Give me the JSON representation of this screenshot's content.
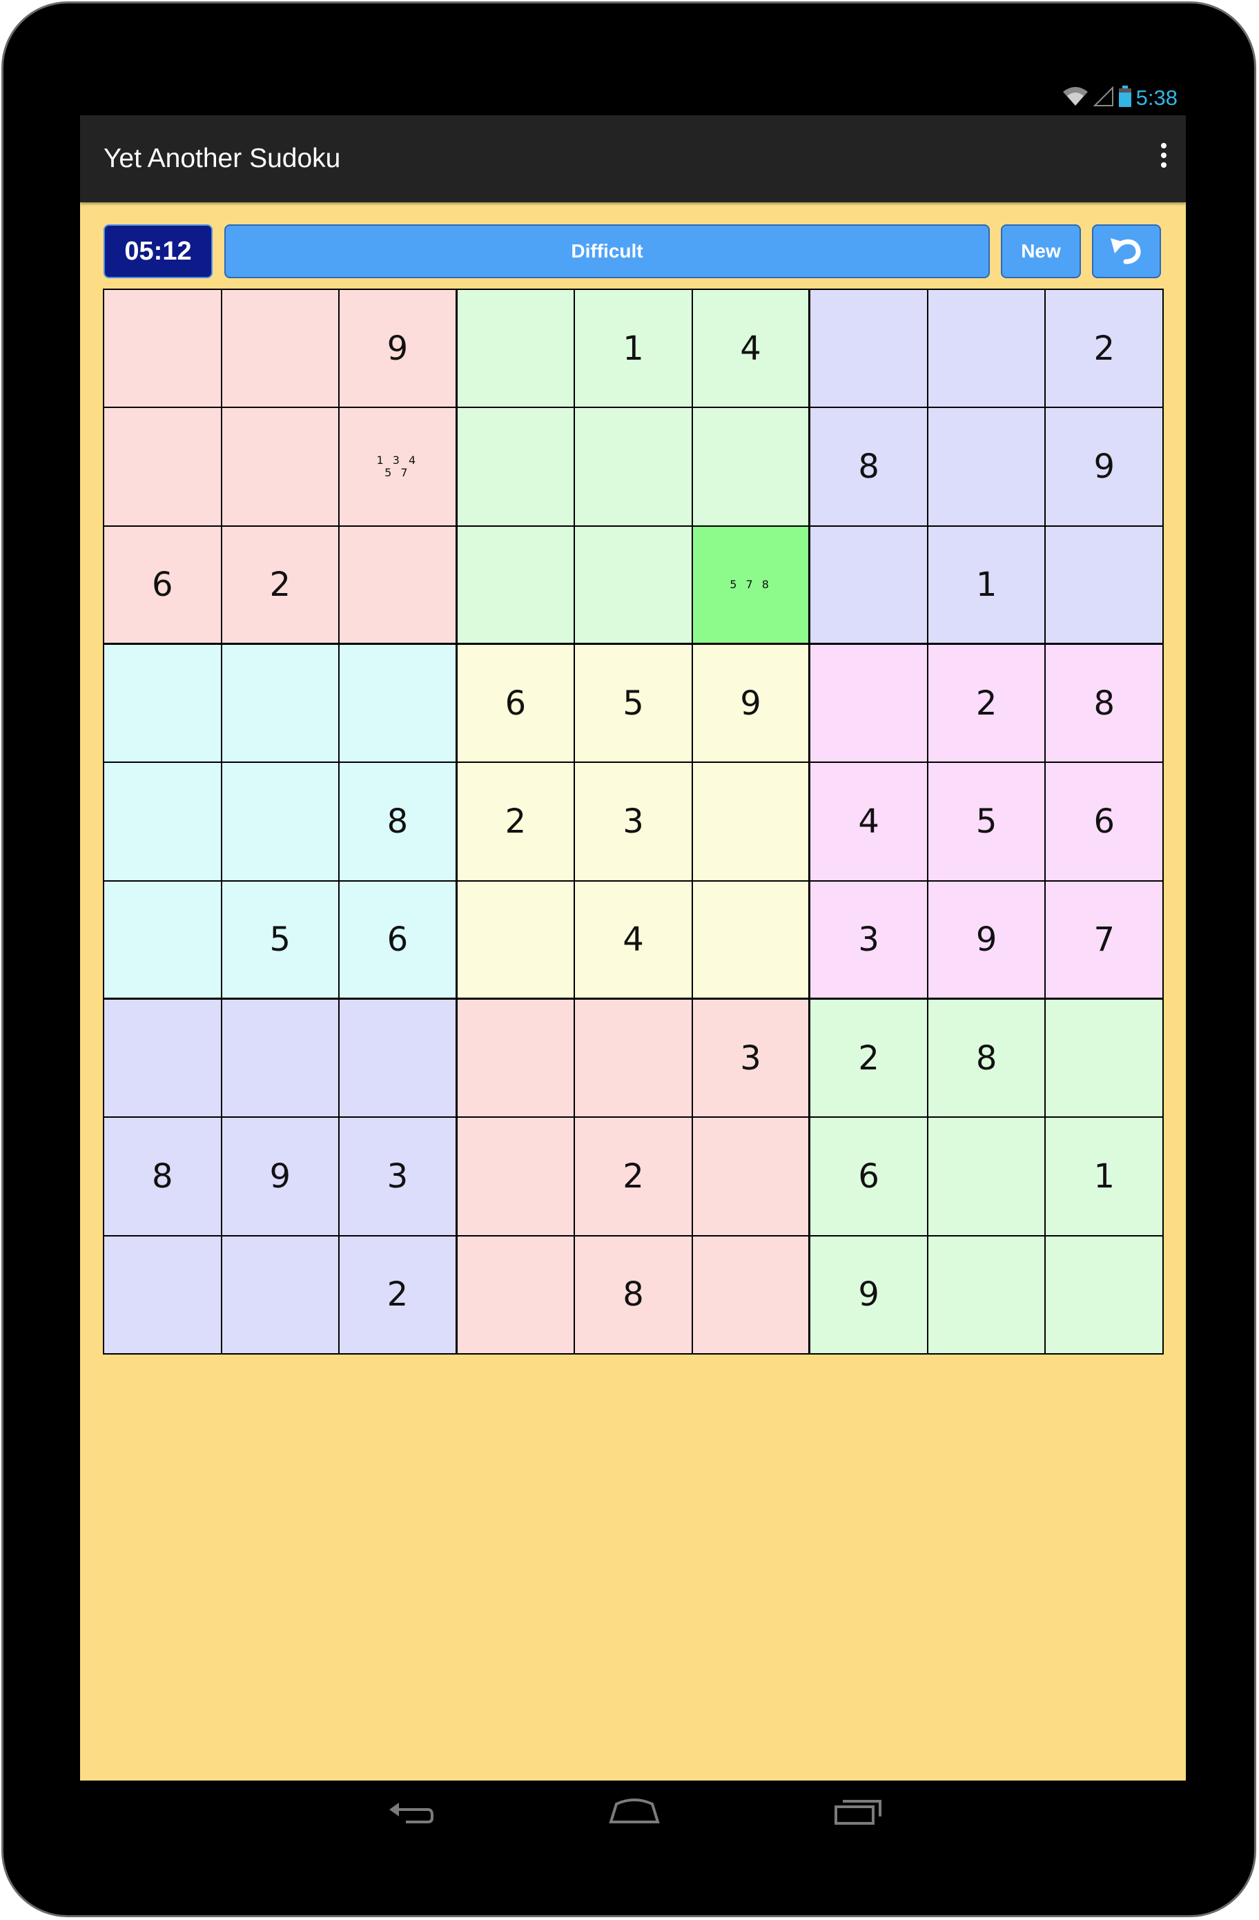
{
  "status_bar": {
    "time": "5:38"
  },
  "app": {
    "title": "Yet Another Sudoku"
  },
  "controls": {
    "timer": "05:12",
    "difficulty": "Difficult",
    "new_label": "New"
  },
  "colors": {
    "blockA": "#fddddb",
    "blockB": "#dcfbdd",
    "blockC": "#dcdcfb",
    "blockD": "#dbfbfb",
    "blockE": "#fcfbdb",
    "blockF": "#fcdcfb",
    "selected": "#8dfb8b"
  },
  "grid": {
    "block_colors": [
      [
        "blockA",
        "blockB",
        "blockC"
      ],
      [
        "blockD",
        "blockE",
        "blockF"
      ],
      [
        "blockC",
        "blockA",
        "blockB"
      ]
    ],
    "cells": [
      [
        "",
        "",
        "9",
        "",
        "1",
        "4",
        "",
        "",
        "2"
      ],
      [
        "",
        "",
        "",
        "",
        "",
        "",
        "8",
        "",
        "9"
      ],
      [
        "6",
        "2",
        "",
        "",
        "",
        "",
        "",
        "1",
        ""
      ],
      [
        "",
        "",
        "",
        "6",
        "5",
        "9",
        "",
        "2",
        "8"
      ],
      [
        "",
        "",
        "8",
        "2",
        "3",
        "",
        "4",
        "5",
        "6"
      ],
      [
        "",
        "5",
        "6",
        "",
        "4",
        "",
        "3",
        "9",
        "7"
      ],
      [
        "",
        "",
        "",
        "",
        "",
        "3",
        "2",
        "8",
        ""
      ],
      [
        "8",
        "9",
        "3",
        "",
        "2",
        "",
        "6",
        "",
        "1"
      ],
      [
        "",
        "",
        "2",
        "",
        "8",
        "",
        "9",
        "",
        ""
      ]
    ],
    "notes": [
      {
        "row": 1,
        "col": 2,
        "text": "1 3 4\n5 7"
      },
      {
        "row": 2,
        "col": 5,
        "text": "5 7 8"
      }
    ],
    "selected": {
      "row": 2,
      "col": 5
    }
  },
  "nav": {
    "back_icon": "back-arrow-icon",
    "home_icon": "home-icon",
    "recents_icon": "recent-apps-icon"
  }
}
